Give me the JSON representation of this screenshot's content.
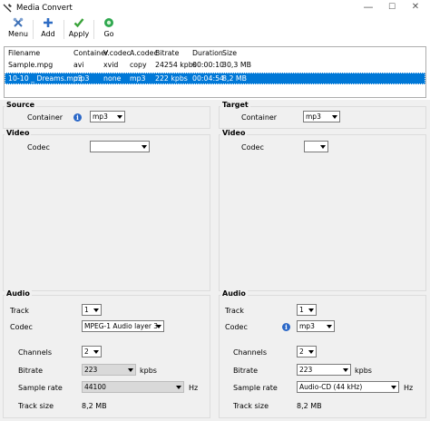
{
  "window": {
    "title": "Media Convert",
    "minimize": "—",
    "maximize": "☐",
    "close": "✕"
  },
  "toolbar": {
    "menu": "Menu",
    "add": "Add",
    "apply": "Apply",
    "go": "Go"
  },
  "files": {
    "columns": [
      "Filename",
      "Container",
      "V.codec",
      "A.codec",
      "Bitrate",
      "Duration",
      "Size"
    ],
    "rows": [
      [
        "Sample.mpg",
        "avi",
        "xvid",
        "copy",
        "24254 kpbs",
        "00:00:10",
        "30,3 MB"
      ],
      [
        "10-10 _ Dreams.mp3",
        "mp3",
        "none",
        "mp3",
        "222 kpbs",
        "00:04:54",
        "8,2 MB"
      ]
    ]
  },
  "source": {
    "title": "Source",
    "container_label": "Container",
    "container": "mp3",
    "video": {
      "title": "Video",
      "codec_label": "Codec",
      "codec": ""
    },
    "audio": {
      "title": "Audio",
      "track_label": "Track",
      "track": "1",
      "codec_label": "Codec",
      "codec": "MPEG-1 Audio layer 3",
      "channels_label": "Channels",
      "channels": "2",
      "bitrate_label": "Bitrate",
      "bitrate": "223",
      "bitrate_unit": "kpbs",
      "samplerate_label": "Sample rate",
      "samplerate": "44100",
      "samplerate_unit": "Hz",
      "tracksize_label": "Track size",
      "tracksize": "8,2 MB"
    }
  },
  "target": {
    "title": "Target",
    "container_label": "Container",
    "container": "mp3",
    "video": {
      "title": "Video",
      "codec_label": "Codec",
      "codec": ""
    },
    "audio": {
      "title": "Audio",
      "track_label": "Track",
      "track": "1",
      "codec_label": "Codec",
      "codec": "mp3",
      "channels_label": "Channels",
      "channels": "2",
      "bitrate_label": "Bitrate",
      "bitrate": "223",
      "bitrate_unit": "kpbs",
      "samplerate_label": "Sample rate",
      "samplerate": "Audio-CD (44 kHz)",
      "samplerate_unit": "Hz",
      "tracksize_label": "Track size",
      "tracksize": "8,2 MB"
    }
  },
  "colors": {
    "selection": "#0078d7",
    "info_icon": "#2a67c7",
    "panel": "#f0f0f0"
  },
  "icons": {
    "info": "i"
  }
}
